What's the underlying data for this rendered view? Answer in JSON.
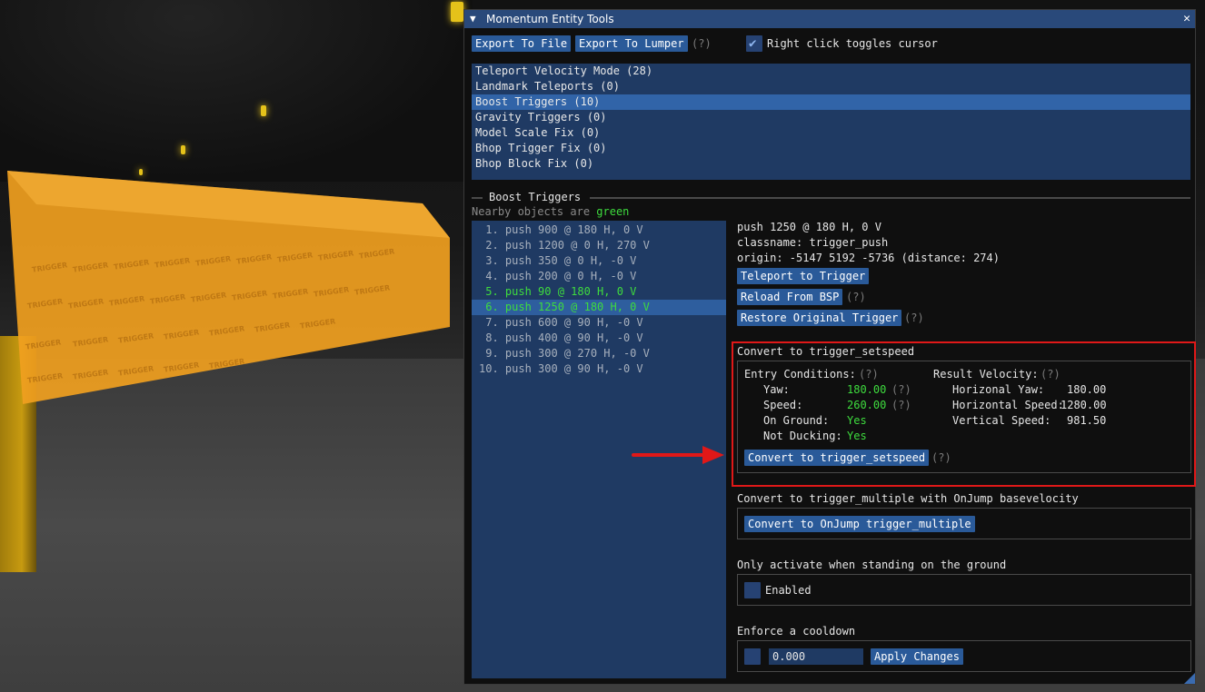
{
  "window": {
    "title": "Momentum Entity Tools",
    "collapse_icon": "▼",
    "close_icon": "✕"
  },
  "toolbar": {
    "export_file": "Export To File",
    "export_lumper": "Export To Lumper",
    "help": "(?)",
    "right_click_label": "Right click toggles cursor",
    "right_click_checked": true
  },
  "modes": [
    {
      "label": "Teleport Velocity Mode (28)",
      "selected": false
    },
    {
      "label": "Landmark Teleports (0)",
      "selected": false
    },
    {
      "label": "Boost Triggers (10)",
      "selected": true
    },
    {
      "label": "Gravity Triggers (0)",
      "selected": false
    },
    {
      "label": "Model Scale Fix (0)",
      "selected": false
    },
    {
      "label": "Bhop Trigger Fix (0)",
      "selected": false
    },
    {
      "label": "Bhop Block Fix (0)",
      "selected": false
    }
  ],
  "section": {
    "title": "Boost Triggers",
    "nearby_prefix": "Nearby objects are ",
    "nearby_color_word": "green"
  },
  "triggers": [
    {
      "label": " 1. push 900 @ 180 H, 0 V",
      "state": "normal"
    },
    {
      "label": " 2. push 1200 @ 0 H, 270 V",
      "state": "normal"
    },
    {
      "label": " 3. push 350 @ 0 H, -0 V",
      "state": "normal"
    },
    {
      "label": " 4. push 200 @ 0 H, -0 V",
      "state": "normal"
    },
    {
      "label": " 5. push 90 @ 180 H, 0 V",
      "state": "near"
    },
    {
      "label": " 6. push 1250 @ 180 H, 0 V",
      "state": "selected"
    },
    {
      "label": " 7. push 600 @ 90 H, -0 V",
      "state": "normal"
    },
    {
      "label": " 8. push 400 @ 90 H, -0 V",
      "state": "normal"
    },
    {
      "label": " 9. push 300 @ 270 H, -0 V",
      "state": "normal"
    },
    {
      "label": "10. push 300 @ 90 H, -0 V",
      "state": "normal"
    }
  ],
  "details": {
    "summary": "push 1250 @ 180 H, 0 V",
    "classname": "classname: trigger_push",
    "origin": "origin: -5147 5192 -5736 (distance: 274)",
    "teleport_btn": "Teleport to Trigger",
    "reload_btn": "Reload From BSP",
    "restore_btn": "Restore Original Trigger"
  },
  "setspeed": {
    "header": "Convert to trigger_setspeed",
    "entry_title": "Entry Conditions:",
    "result_title": "Result Velocity:",
    "yaw_label": "Yaw:",
    "yaw_value": "180.00",
    "speed_label": "Speed:",
    "speed_value": "260.00",
    "ground_label": "On Ground:",
    "ground_value": "Yes",
    "duck_label": "Not Ducking:",
    "duck_value": "Yes",
    "hyaw_label": "Horizonal Yaw:",
    "hyaw_value": "180.00",
    "hspeed_label": "Horizontal Speed:",
    "hspeed_value": "1280.00",
    "vspeed_label": "Vertical Speed:",
    "vspeed_value": "981.50",
    "convert_btn": "Convert to trigger_setspeed"
  },
  "onjump": {
    "header": "Convert to trigger_multiple with OnJump basevelocity",
    "btn": "Convert to OnJump trigger_multiple"
  },
  "ground_only": {
    "header": "Only activate when standing on the ground",
    "checkbox_label": "Enabled",
    "checked": false
  },
  "cooldown": {
    "header": "Enforce a cooldown",
    "value": "0.000",
    "apply_btn": "Apply Changes"
  },
  "colors": {
    "accent": "#2a5a99",
    "highlight_red": "#e01818",
    "nearby_green": "#3edc3e"
  }
}
